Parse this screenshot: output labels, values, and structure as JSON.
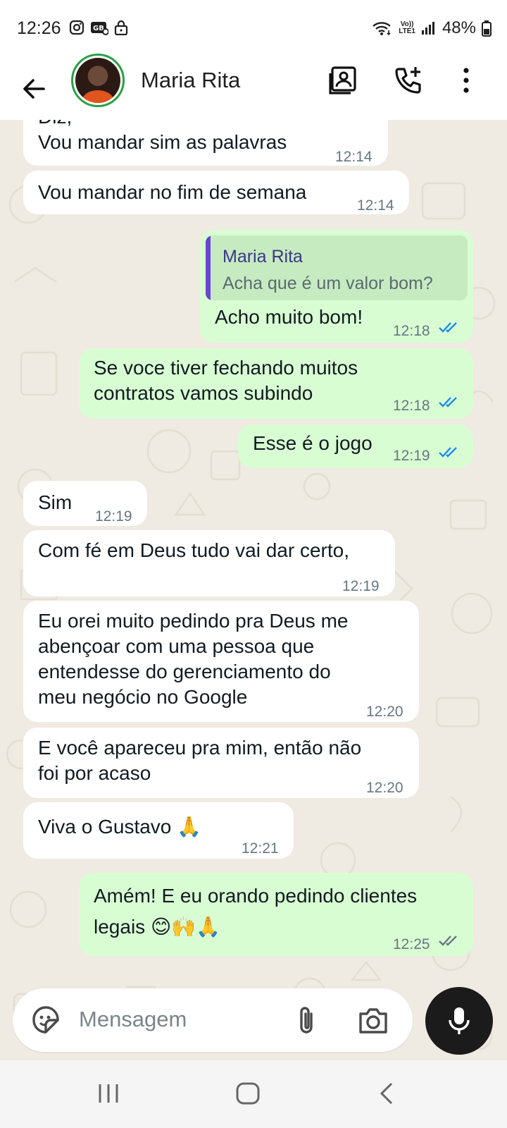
{
  "status_bar": {
    "time": "12:26",
    "volte_top": "Vo))",
    "volte_bottom": "LTE1",
    "battery": "48%"
  },
  "header": {
    "contact_name": "Maria Rita"
  },
  "messages": [
    {
      "dir": "in",
      "text": "Diz,\nVou mandar sim as palavras",
      "time": "12:14"
    },
    {
      "dir": "in",
      "text": "Vou mandar no fim de semana",
      "time": "12:14"
    },
    {
      "dir": "out",
      "quote_name": "Maria Rita",
      "quote_text": "Acha que é um valor bom?",
      "text": "Acho muito bom!",
      "time": "12:18",
      "status": "read"
    },
    {
      "dir": "out",
      "text": "Se voce tiver fechando muitos\ncontratos vamos subindo",
      "time": "12:18",
      "status": "read"
    },
    {
      "dir": "out",
      "text": "Esse é o jogo",
      "time": "12:19",
      "status": "read"
    },
    {
      "dir": "in",
      "text": "Sim",
      "time": "12:19"
    },
    {
      "dir": "in",
      "text": "Com fé em Deus tudo vai dar certo,",
      "time": "12:19"
    },
    {
      "dir": "in",
      "text": "Eu orei muito pedindo pra Deus me\nabençoar com uma pessoa que\nentendesse do gerenciamento do\nmeu negócio no Google",
      "time": "12:20"
    },
    {
      "dir": "in",
      "text": "E você apareceu pra mim, então não\nfoi por acaso",
      "time": "12:20"
    },
    {
      "dir": "in",
      "text": "Viva o Gustavo 🙏",
      "time": "12:21"
    },
    {
      "dir": "out",
      "text": "Amém! E eu orando pedindo clientes\nlegais 😊🙌🙏",
      "time": "12:25",
      "status": "delivered"
    }
  ],
  "input": {
    "placeholder": "Mensagem"
  },
  "colors": {
    "chat_bg": "#efeae2",
    "incoming_bubble": "#ffffff",
    "outgoing_bubble": "#d9fdd3",
    "read_ticks": "#1c8cf0",
    "delivered_ticks": "#667781",
    "avatar_ring": "#25a244"
  },
  "icons": [
    "back-arrow-icon",
    "contact-card-icon",
    "add-call-icon",
    "more-vert-icon",
    "sticker-icon",
    "attach-icon",
    "camera-icon",
    "mic-icon"
  ]
}
